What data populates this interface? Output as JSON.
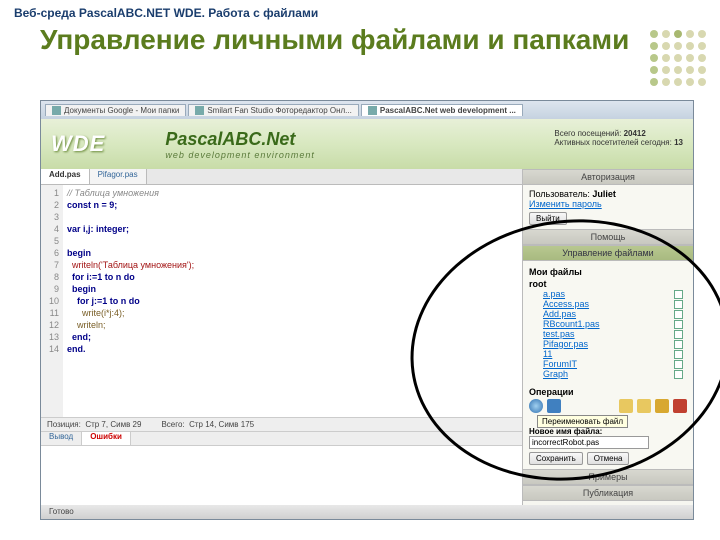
{
  "slide": {
    "header": "Веб-среда PascalABC.NET WDE. Работа с файлами",
    "title": "Управление личными файлами и папками"
  },
  "browser_tabs": [
    {
      "label": "Документы Google - Мои папки"
    },
    {
      "label": "Smilart Fan Studio Фоторедактор Онл..."
    },
    {
      "label": "PascalABC.Net web development ..."
    }
  ],
  "banner": {
    "logo": "WDE",
    "brand_top": "PascalABC.Net",
    "brand_sub": "web development environment",
    "visits_label": "Всего посещений:",
    "visits": "20412",
    "active_label": "Активных посетителей сегодня:",
    "active": "13"
  },
  "editor": {
    "tabs": [
      {
        "label": "Add.pas"
      },
      {
        "label": "Pifagor.pas"
      }
    ],
    "lines": [
      {
        "n": "1",
        "text": "// Таблица умножения",
        "cls": "cm"
      },
      {
        "n": "2",
        "text": "const n = 9;",
        "cls": "kw"
      },
      {
        "n": "3",
        "text": " ",
        "cls": ""
      },
      {
        "n": "4",
        "text": "var i,j: integer;",
        "cls": "kw"
      },
      {
        "n": "5",
        "text": " ",
        "cls": ""
      },
      {
        "n": "6",
        "text": "begin",
        "cls": "kw"
      },
      {
        "n": "7",
        "text": "  writeln('Таблица умножения');",
        "cls": "str"
      },
      {
        "n": "8",
        "text": "  for i:=1 to n do",
        "cls": "kw"
      },
      {
        "n": "9",
        "text": "  begin",
        "cls": "kw"
      },
      {
        "n": "10",
        "text": "    for j:=1 to n do",
        "cls": "kw"
      },
      {
        "n": "11",
        "text": "      write(i*j:4);",
        "cls": "fn"
      },
      {
        "n": "12",
        "text": "    writeln;",
        "cls": "fn"
      },
      {
        "n": "13",
        "text": "  end;",
        "cls": "kw"
      },
      {
        "n": "14",
        "text": "end.",
        "cls": "kw"
      }
    ],
    "pos": {
      "pos_label": "Позиция:",
      "pos_val": "Стр 7, Симв 29",
      "total_label": "Всего:",
      "total_val": "Стр 14, Симв 175"
    },
    "out_tabs": {
      "out": "Вывод",
      "err": "Ошибки"
    }
  },
  "side": {
    "sec_auth": "Авторизация",
    "user_label": "Пользователь:",
    "user_name": "Juliet",
    "change_pw": "Изменить пароль",
    "logout": "Выйти",
    "sec_help": "Помощь",
    "sec_files": "Управление файлами",
    "my_files": "Мои файлы",
    "root": "root",
    "files": [
      {
        "name": "a.pas",
        "type": "file"
      },
      {
        "name": "Access.pas",
        "type": "file"
      },
      {
        "name": "Add.pas",
        "type": "file"
      },
      {
        "name": "RBcount1.pas",
        "type": "file"
      },
      {
        "name": "test.pas",
        "type": "file"
      },
      {
        "name": "Pifagor.pas",
        "type": "file"
      },
      {
        "name": "11",
        "type": "folder"
      },
      {
        "name": "ForumIT",
        "type": "folder"
      },
      {
        "name": "Graph",
        "type": "folder"
      }
    ],
    "ops_label": "Операции",
    "tooltip": "Переименовать файл",
    "rename_label": "Новое имя файла:",
    "rename_value": "incorrectRobot.pas",
    "save": "Сохранить",
    "cancel": "Отмена",
    "sec_examples": "Примеры",
    "sec_publish": "Публикация"
  },
  "status": "Готово"
}
